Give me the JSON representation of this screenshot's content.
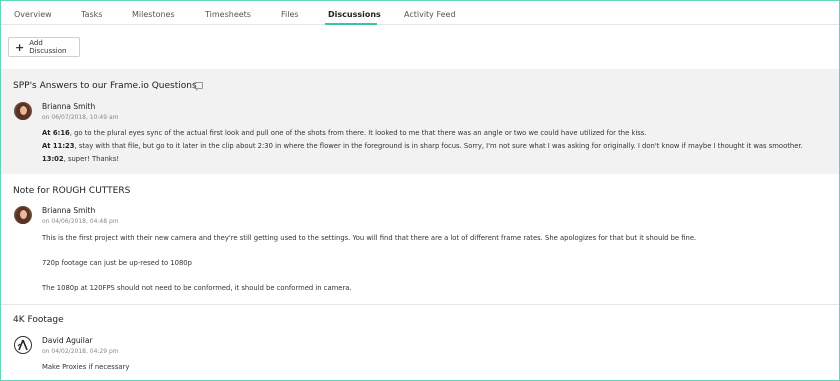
{
  "tabs": [
    {
      "label": "Overview"
    },
    {
      "label": "Tasks"
    },
    {
      "label": "Milestones"
    },
    {
      "label": "Timesheets"
    },
    {
      "label": "Files"
    },
    {
      "label": "Discussions",
      "active": true
    },
    {
      "label": "Activity Feed"
    }
  ],
  "toolbar": {
    "add_label": "Add Discussion",
    "add_icon": "plus-icon"
  },
  "colors": {
    "accent": "#37c4a8",
    "border": "#5fd6b8",
    "shaded_row": "#f2f2f2"
  },
  "discussions": [
    {
      "title": "SPP's Answers to our Frame.io Questions",
      "author": "Brianna Smith",
      "date": "on 06/07/2018, 10:49 am",
      "lines": [
        {
          "time": "At 6:16",
          "text": ", go to the plural eyes sync of the actual first look and pull one of the shots from there. It looked to me that there was an angle or two we could have utilized for the kiss."
        },
        {
          "time": "At 11:23",
          "text": ", stay with that file, but go to it later in the clip about 2:30 in where the flower in the foreground is in sharp focus. Sorry, I'm not sure what I was asking for originally. I don't know if maybe I thought it was smoother."
        },
        {
          "time": "13:02",
          "text": ", super! Thanks!"
        }
      ]
    },
    {
      "title": "Note for ROUGH CUTTERS",
      "author": "Brianna Smith",
      "date": "on 04/06/2018, 04:48 pm",
      "paragraphs": [
        "This is the first project with their new camera and they're still getting used to the settings. You will find that there are a lot of different frame rates. She apologizes for that but it should be fine.",
        "720p footage can just be up-resed to 1080p",
        "The 1080p at 120FPS should not need to be conformed, it should be conformed in camera."
      ]
    },
    {
      "title": "4K Footage",
      "author": "David Aguilar",
      "date": "on 04/02/2018, 04:29 pm",
      "paragraphs": [
        "Make Proxies if necessary"
      ]
    }
  ]
}
